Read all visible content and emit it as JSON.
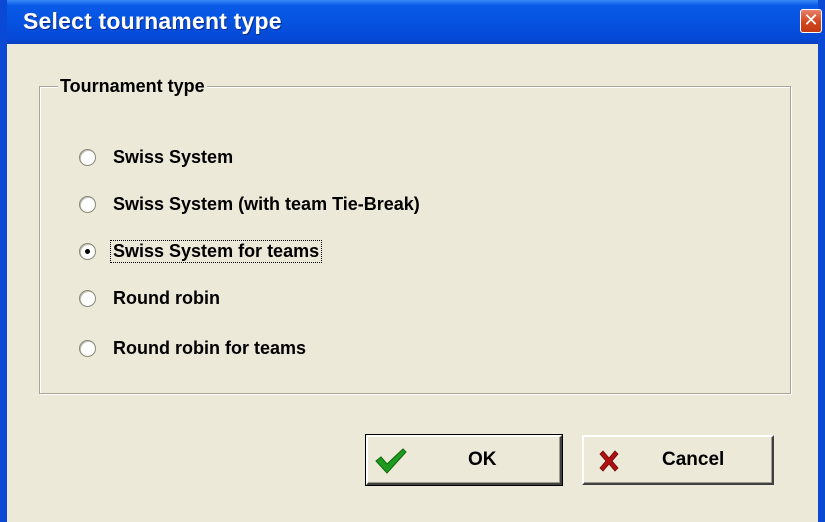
{
  "window": {
    "title": "Select tournament type"
  },
  "group": {
    "label": "Tournament type",
    "options": [
      {
        "label": "Swiss System",
        "selected": false
      },
      {
        "label": "Swiss System (with team Tie-Break)",
        "selected": false
      },
      {
        "label": "Swiss System for teams",
        "selected": true
      },
      {
        "label": "Round robin",
        "selected": false
      },
      {
        "label": "Round robin for teams",
        "selected": false
      }
    ]
  },
  "buttons": {
    "ok_label": "OK",
    "cancel_label": "Cancel"
  },
  "icons": {
    "close": "close-icon",
    "ok": "checkmark-icon",
    "cancel": "x-mark-icon"
  },
  "colors": {
    "titlebar": "#0553E0",
    "dialog_bg": "#ECE9D8",
    "checkmark": "#1E9A1E",
    "cancel_x": "#B01010"
  }
}
